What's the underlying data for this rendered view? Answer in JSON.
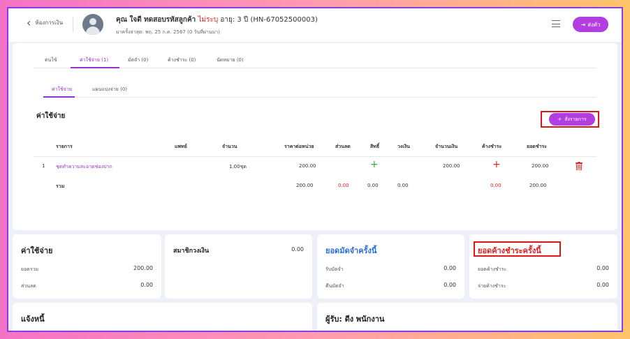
{
  "header": {
    "back_label": "ห้องการเงิน",
    "patient_prefix": "คุณ ใจดี ทดสอบรหัสลูกค้า",
    "patient_gender": "ไม่ระบุ",
    "patient_suffix": "อายุ: 3 ปี (HN-67052500003)",
    "last_visit": "มาครั้งล่าสุด: พฤ. 25 ก.ค. 2567 (0 วันที่ผ่านมา)",
    "send_label": "ส่งตัว"
  },
  "tabs": [
    {
      "label": "ตนไข้"
    },
    {
      "label": "ค่าใช้จ่าย (1)"
    },
    {
      "label": "มัดจำ (0)"
    },
    {
      "label": "ค้างชำระ (0)"
    },
    {
      "label": "นัดหมาย (0)"
    }
  ],
  "subtabs": [
    {
      "label": "ค่าใช้จ่าย"
    },
    {
      "label": "แผนแบ่งจ่าย (0)"
    }
  ],
  "section_title": "ค่าใช้จ่าย",
  "add_button_label": "สั่งรายการ",
  "table": {
    "headers": [
      "รายการ",
      "แพทย์",
      "จำนวน",
      "ราคาต่อหน่วย",
      "ส่วนลด",
      "สิทธิ์",
      "วงเงิน",
      "จำนวนเงิน",
      "ค้างชำระ",
      "ยอดชำระ"
    ],
    "row": {
      "index": "1",
      "item": "ชุดทำความสะอาดช่องปาก",
      "doctor": "",
      "qty": "1.00ชุด",
      "unit_price": "200.00",
      "amount": "200.00",
      "paid": "200.00"
    },
    "total": {
      "label": "รวม",
      "unit_price": "200.00",
      "discount": "0.00",
      "rights": "0.00",
      "limit": "0.00",
      "outstanding": "0.00",
      "paid": "200.00"
    }
  },
  "summary": {
    "expense": {
      "title": "ค่าใช้จ่าย",
      "total_label": "ยอดรวม",
      "total_value": "200.00",
      "discount_label": "ส่วนลด",
      "discount_value": "0.00"
    },
    "member": {
      "title": "สมาชิกวงเงิน",
      "value": "0.00"
    },
    "deposit": {
      "title": "ยอดมัดจำครั้งนี้",
      "receive_label": "รับมัดจำ",
      "receive_value": "0.00",
      "refund_label": "คืนมัดจำ",
      "refund_value": "0.00"
    },
    "outstanding": {
      "title": "ยอดค้างชำระครั้งนี้",
      "total_label": "ยอดค้างชำระ",
      "total_value": "0.00",
      "pay_label": "จ่ายค้างชำระ",
      "pay_value": "0.00"
    }
  },
  "bottom": {
    "notify_title": "แจ้งหนี้",
    "receiver_title": "ผู้รับ: ดีง พนักงาน"
  },
  "colors": {
    "accent": "#9b2fd6",
    "highlight": "#e01515",
    "blue": "#2a6fe0",
    "red": "#e02020",
    "green": "#2ea84a"
  }
}
